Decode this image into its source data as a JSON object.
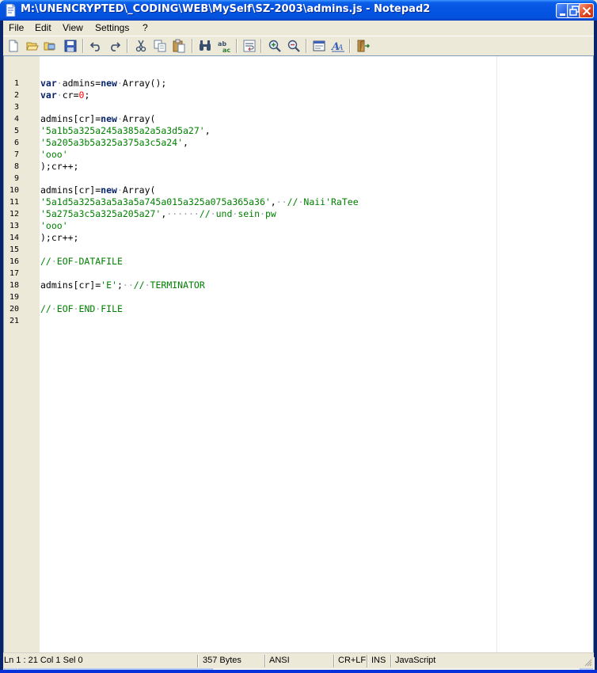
{
  "window": {
    "title": "M:\\UNENCRYPTED\\_CODING\\WEB\\MySelf\\SZ-2003\\admins.js - Notepad2"
  },
  "menu": {
    "file": "File",
    "edit": "Edit",
    "view": "View",
    "settings": "Settings",
    "help": "?"
  },
  "toolbar": {
    "icons": [
      "new-icon",
      "open-icon",
      "browse-icon",
      "save-icon",
      "undo-icon",
      "redo-icon",
      "cut-icon",
      "copy-icon",
      "paste-icon",
      "find-icon",
      "replace-icon",
      "word-wrap-icon",
      "zoom-in-icon",
      "zoom-out-icon",
      "scheme-icon",
      "font-icon",
      "exit-icon"
    ]
  },
  "editor": {
    "line_numbers": [
      "1",
      "2",
      "3",
      "4",
      "5",
      "6",
      "7",
      "8",
      "9",
      "10",
      "11",
      "12",
      "13",
      "14",
      "15",
      "16",
      "17",
      "18",
      "19",
      "20",
      "21"
    ],
    "colors": {
      "keyword": "#0a246a",
      "number": "#ff0000",
      "string": "#008000",
      "comment": "#008000",
      "whitespace": "#9aa5b0"
    },
    "lines": [
      [
        {
          "t": "kw",
          "v": "var"
        },
        {
          "t": "ws",
          "v": "·"
        },
        {
          "t": "p",
          "v": "admins="
        },
        {
          "t": "kw",
          "v": "new"
        },
        {
          "t": "ws",
          "v": "·"
        },
        {
          "t": "p",
          "v": "Array();"
        }
      ],
      [
        {
          "t": "kw",
          "v": "var"
        },
        {
          "t": "ws",
          "v": "·"
        },
        {
          "t": "p",
          "v": "cr="
        },
        {
          "t": "num",
          "v": "0"
        },
        {
          "t": "p",
          "v": ";"
        }
      ],
      [],
      [
        {
          "t": "p",
          "v": "admins[cr]="
        },
        {
          "t": "kw",
          "v": "new"
        },
        {
          "t": "ws",
          "v": "·"
        },
        {
          "t": "p",
          "v": "Array("
        }
      ],
      [
        {
          "t": "str",
          "v": "'5a1b5a325a245a385a2a5a3d5a27'"
        },
        {
          "t": "p",
          "v": ","
        }
      ],
      [
        {
          "t": "str",
          "v": "'5a205a3b5a325a375a3c5a24'"
        },
        {
          "t": "p",
          "v": ","
        }
      ],
      [
        {
          "t": "str",
          "v": "'ooo'"
        }
      ],
      [
        {
          "t": "p",
          "v": ");cr++;"
        }
      ],
      [],
      [
        {
          "t": "p",
          "v": "admins[cr]="
        },
        {
          "t": "kw",
          "v": "new"
        },
        {
          "t": "ws",
          "v": "·"
        },
        {
          "t": "p",
          "v": "Array("
        }
      ],
      [
        {
          "t": "str",
          "v": "'5a1d5a325a3a5a3a5a745a015a325a075a365a36'"
        },
        {
          "t": "p",
          "v": ","
        },
        {
          "t": "ws",
          "v": "··"
        },
        {
          "t": "cmt",
          "v": "//"
        },
        {
          "t": "ws",
          "v": "·"
        },
        {
          "t": "cmt",
          "v": "Naii'RaTee"
        }
      ],
      [
        {
          "t": "str",
          "v": "'5a275a3c5a325a205a27'"
        },
        {
          "t": "p",
          "v": ","
        },
        {
          "t": "ws",
          "v": "······"
        },
        {
          "t": "cmt",
          "v": "//"
        },
        {
          "t": "ws",
          "v": "·"
        },
        {
          "t": "cmt",
          "v": "und"
        },
        {
          "t": "ws",
          "v": "·"
        },
        {
          "t": "cmt",
          "v": "sein"
        },
        {
          "t": "ws",
          "v": "·"
        },
        {
          "t": "cmt",
          "v": "pw"
        }
      ],
      [
        {
          "t": "str",
          "v": "'ooo'"
        }
      ],
      [
        {
          "t": "p",
          "v": ");cr++;"
        }
      ],
      [],
      [
        {
          "t": "cmt",
          "v": "//"
        },
        {
          "t": "ws",
          "v": "·"
        },
        {
          "t": "cmt",
          "v": "EOF-DATAFILE"
        }
      ],
      [],
      [
        {
          "t": "p",
          "v": "admins[cr]="
        },
        {
          "t": "str",
          "v": "'E'"
        },
        {
          "t": "p",
          "v": ";"
        },
        {
          "t": "ws",
          "v": "··"
        },
        {
          "t": "cmt",
          "v": "//"
        },
        {
          "t": "ws",
          "v": "·"
        },
        {
          "t": "cmt",
          "v": "TERMINATOR"
        }
      ],
      [],
      [
        {
          "t": "cmt",
          "v": "//"
        },
        {
          "t": "ws",
          "v": "·"
        },
        {
          "t": "cmt",
          "v": "EOF"
        },
        {
          "t": "ws",
          "v": "·"
        },
        {
          "t": "cmt",
          "v": "END"
        },
        {
          "t": "ws",
          "v": "·"
        },
        {
          "t": "cmt",
          "v": "FILE"
        }
      ],
      []
    ]
  },
  "status": {
    "position": "Ln 1 : 21   Col 1   Sel 0",
    "size": "357 Bytes",
    "encoding": "ANSI",
    "line_endings": "CR+LF",
    "mode": "INS",
    "lexer": "JavaScript"
  }
}
